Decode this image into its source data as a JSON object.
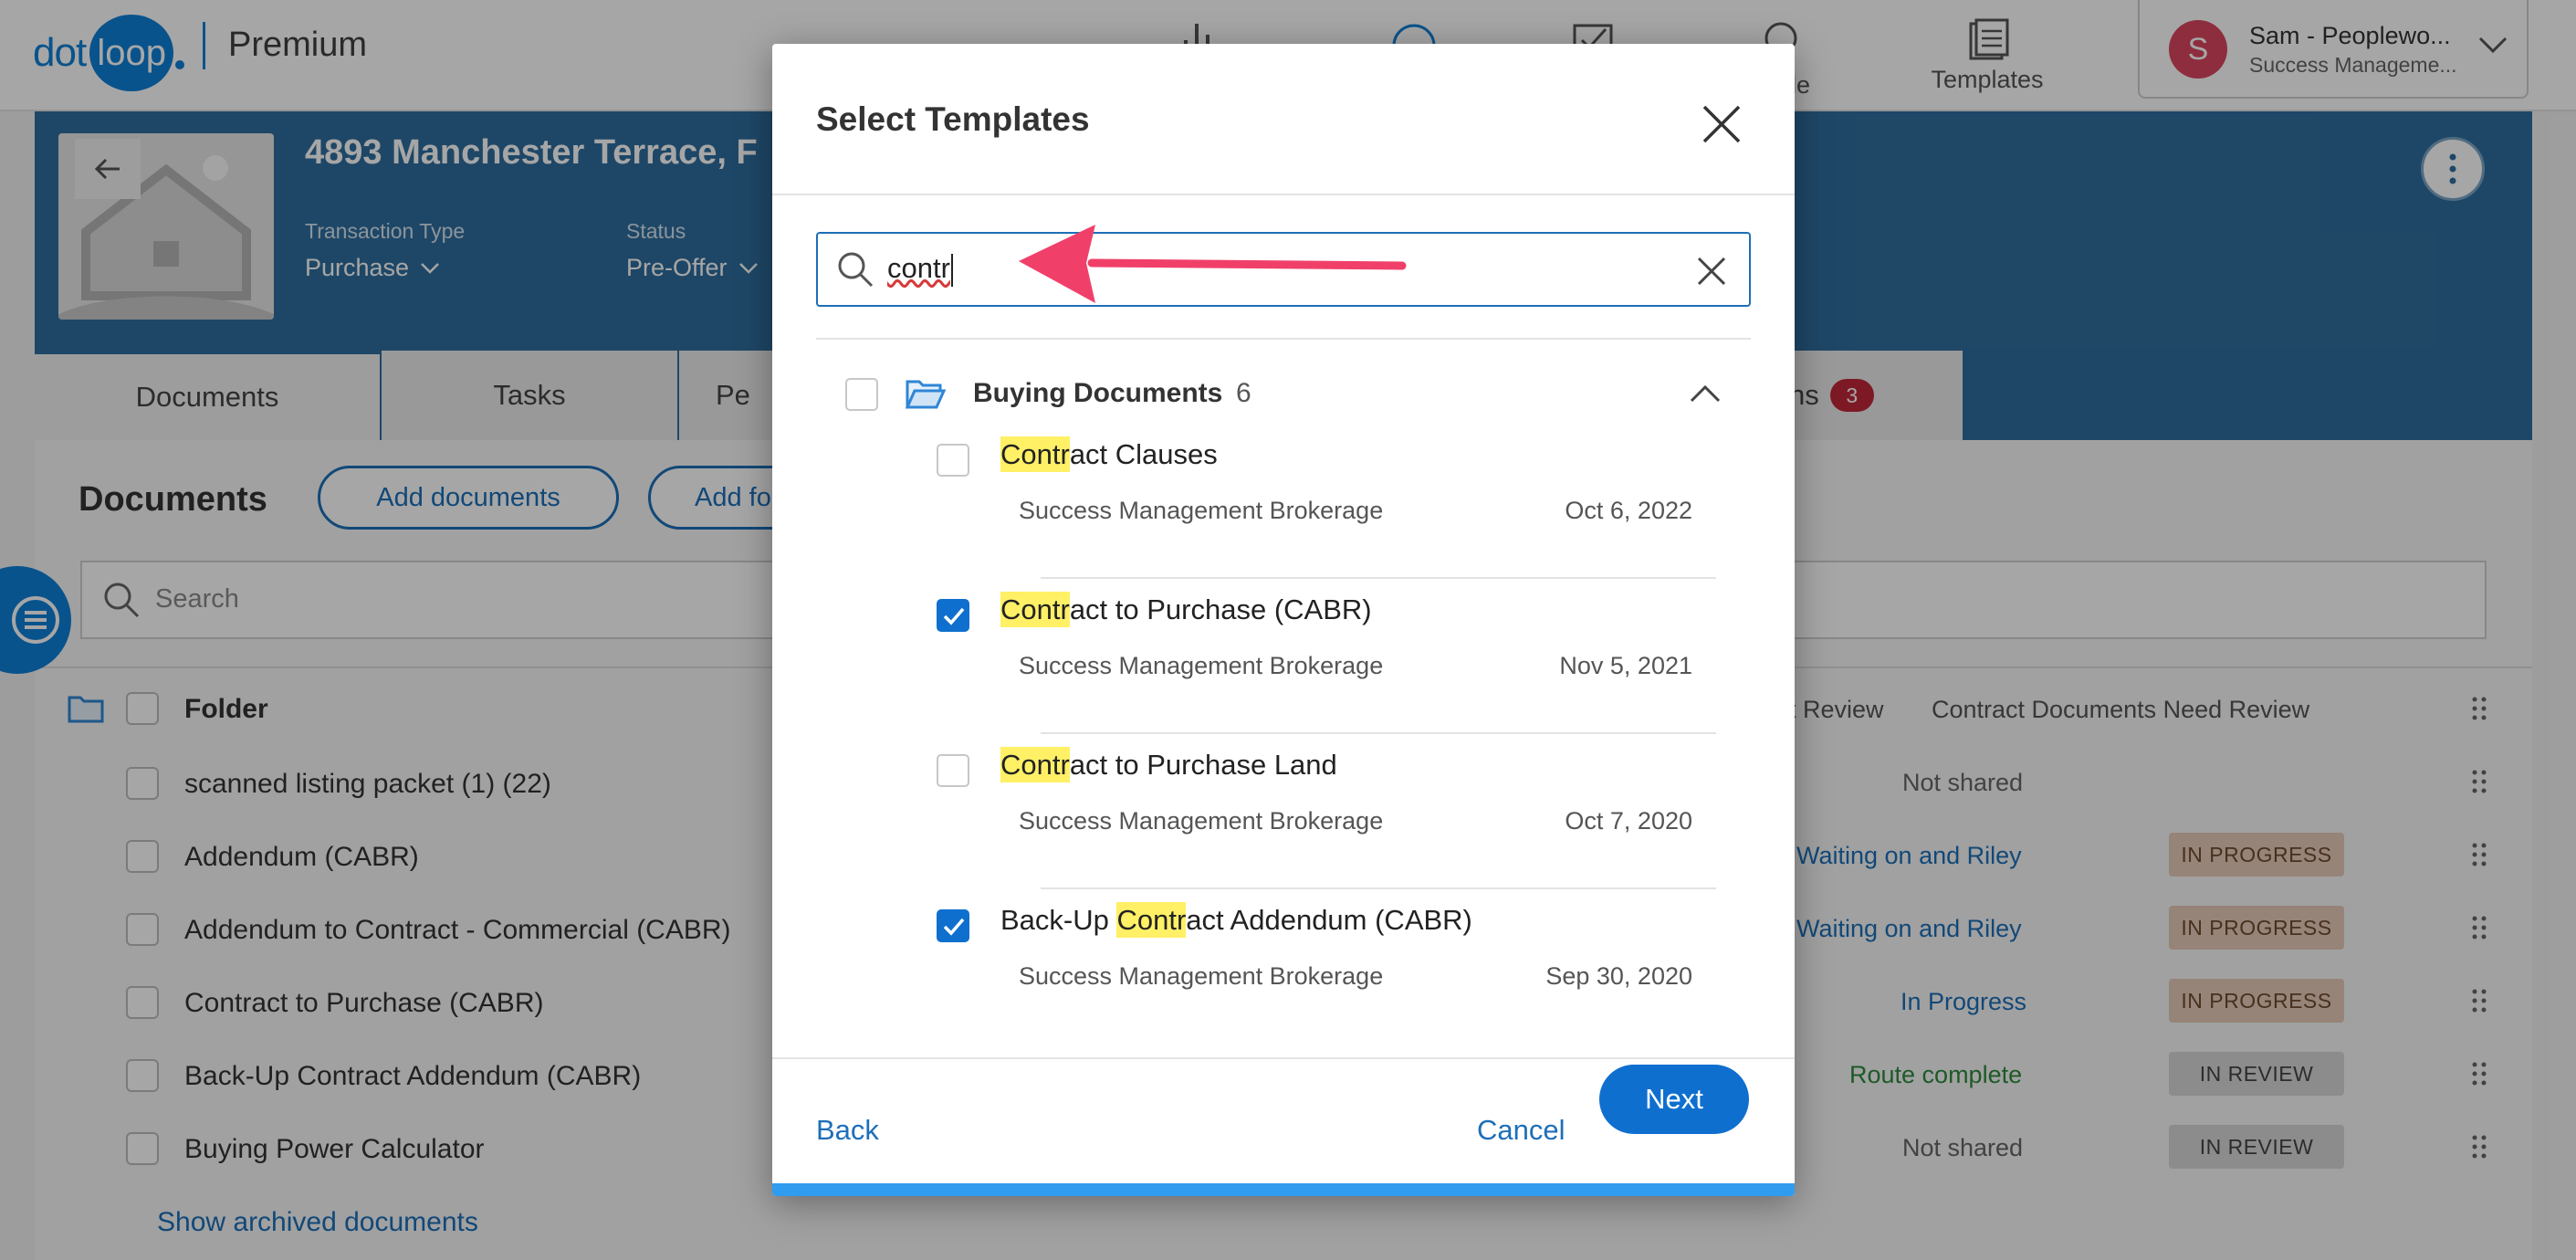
{
  "app": {
    "brand_dot": "dot",
    "brand_loop": "loop",
    "plan": "Premium"
  },
  "nav": {
    "partial_label": "le",
    "templates_label": "Templates"
  },
  "user": {
    "initial": "S",
    "name": "Sam - Peoplewo...",
    "org": "Success Manageme..."
  },
  "transaction": {
    "address": "4893 Manchester Terrace, F",
    "type_label": "Transaction Type",
    "type_value": "Purchase",
    "status_label": "Status",
    "status_value": "Pre-Offer"
  },
  "tabs": [
    {
      "label": "Documents"
    },
    {
      "label": "Tasks"
    },
    {
      "label": "Pe"
    },
    {
      "label": "ns",
      "badge": "3"
    }
  ],
  "documents": {
    "title": "Documents",
    "add_documents": "Add documents",
    "add_folder": "Add fo",
    "search_placeholder": "Search",
    "folder_header": "Folder",
    "col_review": "t Review",
    "col_contract": "Contract Documents Need Review",
    "rows": [
      {
        "name": "scanned listing packet (1) (22)",
        "status_text": "Not shared",
        "pill": ""
      },
      {
        "name": "Addendum (CABR)",
        "status_text": "Waiting on and Riley",
        "pill": "IN PROGRESS"
      },
      {
        "name": "Addendum to Contract - Commercial (CABR)",
        "status_text": "Waiting on and Riley",
        "pill": "IN PROGRESS"
      },
      {
        "name": "Contract to Purchase (CABR)",
        "status_text": "In Progress",
        "pill": "IN PROGRESS"
      },
      {
        "name": "Back-Up Contract Addendum (CABR)",
        "status_text": "Route complete",
        "pill": "IN REVIEW"
      },
      {
        "name": "Buying Power Calculator",
        "status_text": "Not shared",
        "pill": "IN REVIEW"
      }
    ],
    "show_archived": "Show archived documents"
  },
  "modal": {
    "title": "Select Templates",
    "search_value": "contr",
    "folder": {
      "name": "Buying Documents",
      "count": "6"
    },
    "items": [
      {
        "pre": "",
        "hl": "Contr",
        "post": "act Clauses",
        "org": "Success Management Brokerage",
        "date": "Oct 6, 2022",
        "checked": false
      },
      {
        "pre": "",
        "hl": "Contr",
        "post": "act to Purchase (CABR)",
        "org": "Success Management Brokerage",
        "date": "Nov 5, 2021",
        "checked": true
      },
      {
        "pre": "",
        "hl": "Contr",
        "post": "act to Purchase Land",
        "org": "Success Management Brokerage",
        "date": "Oct 7, 2020",
        "checked": false
      },
      {
        "pre": "Back-Up ",
        "hl": "Contr",
        "post": "act Addendum (CABR)",
        "org": "Success Management Brokerage",
        "date": "Sep 30, 2020",
        "checked": true
      }
    ],
    "back": "Back",
    "cancel": "Cancel",
    "next": "Next"
  },
  "colors": {
    "accent": "#0f6fcf",
    "banner": "#2f6e9e",
    "highlight": "#fff066",
    "annotation_arrow": "#f0406a",
    "avatar": "#d9465e"
  }
}
